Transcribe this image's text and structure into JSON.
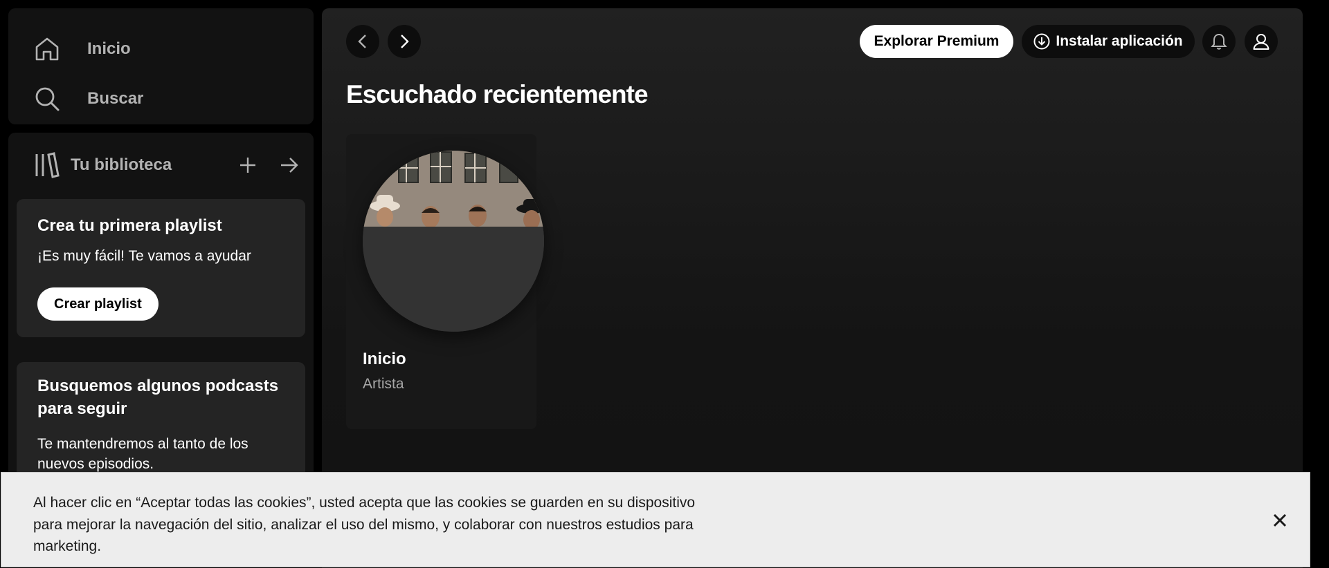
{
  "sidebar": {
    "nav": {
      "home_label": "Inicio",
      "search_label": "Buscar"
    },
    "library": {
      "label": "Tu biblioteca",
      "promos": [
        {
          "title": "Crea tu primera playlist",
          "text": "¡Es muy fácil! Te vamos a ayudar",
          "button": "Crear playlist"
        },
        {
          "title": "Busquemos algunos podcasts para seguir",
          "text": "Te mantendremos al tanto de los nuevos episodios."
        }
      ]
    }
  },
  "header": {
    "premium_label": "Explorar Premium",
    "install_label": "Instalar aplicación"
  },
  "main": {
    "section_title": "Escuchado recientemente",
    "cards": [
      {
        "title": "Inicio",
        "subtitle": "Artista"
      }
    ]
  },
  "cookie_banner": {
    "text": "Al hacer clic en “Aceptar todas las cookies”, usted acepta que las cookies se guarden en su dispositivo para mejorar la navegación del sitio, analizar el uso del mismo, y colaborar con nuestros estudios para marketing."
  },
  "icons": {
    "home": "home-icon",
    "search": "search-icon",
    "library": "library-icon",
    "add": "plus-icon",
    "expand": "arrow-right-icon",
    "back": "chevron-left-icon",
    "forward": "chevron-right-icon",
    "install": "download-circle-icon",
    "notifications": "bell-icon",
    "user": "user-icon",
    "close": "close-icon"
  },
  "colors": {
    "background": "#000000",
    "panel": "#121212",
    "card": "#242424",
    "text_secondary": "#b3b3b3",
    "cookie_bg": "#ededed"
  }
}
